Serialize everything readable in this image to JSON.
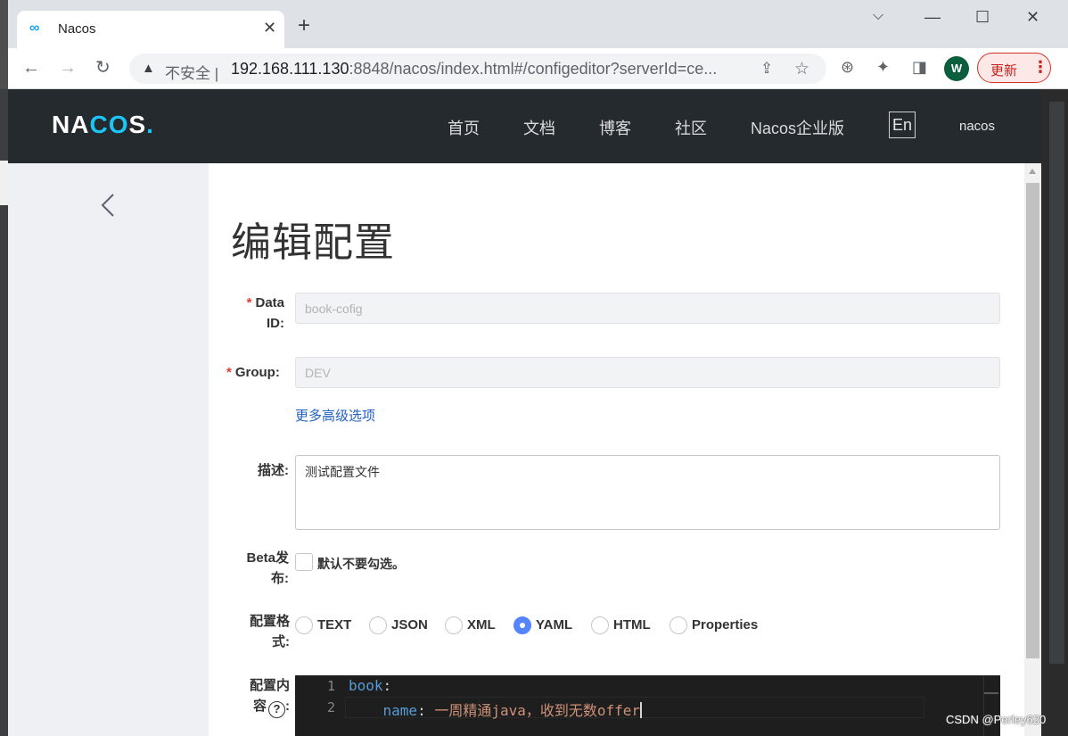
{
  "browser": {
    "tab_title": "Nacos",
    "tab_icon": "∞",
    "tab_close": "✕",
    "new_tab": "+",
    "window_controls": {
      "minimize": "—",
      "maximize": "☐",
      "close": "✕",
      "tabsearch": "⌵"
    },
    "nav": {
      "back": "←",
      "forward": "→",
      "reload": "↻"
    },
    "security_warning": "▲",
    "insecure_label": "不安全 |",
    "url_host": "192.168.111.130",
    "url_rest": ":8848/nacos/index.html#/configeditor?serverId=ce...",
    "share": "⇪",
    "star": "☆",
    "ext_icons": [
      "⊛",
      "✦",
      "◨"
    ],
    "avatar": "W",
    "update_label": "更新",
    "update_menu": "⋮"
  },
  "header": {
    "logo_parts": [
      "NA",
      "C",
      "O",
      "S",
      "."
    ],
    "nav": [
      "首页",
      "文档",
      "博客",
      "社区",
      "Nacos企业版"
    ],
    "lang": "En",
    "user": "nacos"
  },
  "form": {
    "title": "编辑配置",
    "data_id": {
      "required": "*",
      "label_line1": "Data",
      "label_line2": "ID:",
      "placeholder": "book-cofig"
    },
    "group": {
      "required": "*",
      "label": "Group:",
      "placeholder": "DEV"
    },
    "advanced": "更多高级选项",
    "desc": {
      "label": "描述:",
      "value": "测试配置文件"
    },
    "beta": {
      "label_line1": "Beta发",
      "label_line2": "布:",
      "text": "默认不要勾选。"
    },
    "format": {
      "label_line1": "配置格",
      "label_line2": "式:",
      "options": [
        "TEXT",
        "JSON",
        "XML",
        "YAML",
        "HTML",
        "Properties"
      ],
      "selected": "YAML"
    },
    "content": {
      "label_line1": "配置内",
      "label_line2": "容",
      "help": "?",
      "colon": ":",
      "lines": [
        {
          "num": "1",
          "key": "book",
          "sep": ":",
          "value": ""
        },
        {
          "num": "2",
          "key": "    name",
          "sep": ": ",
          "value": "一周精通java，收到无数offer"
        }
      ]
    }
  },
  "watermark": "CSDN @Perley620"
}
